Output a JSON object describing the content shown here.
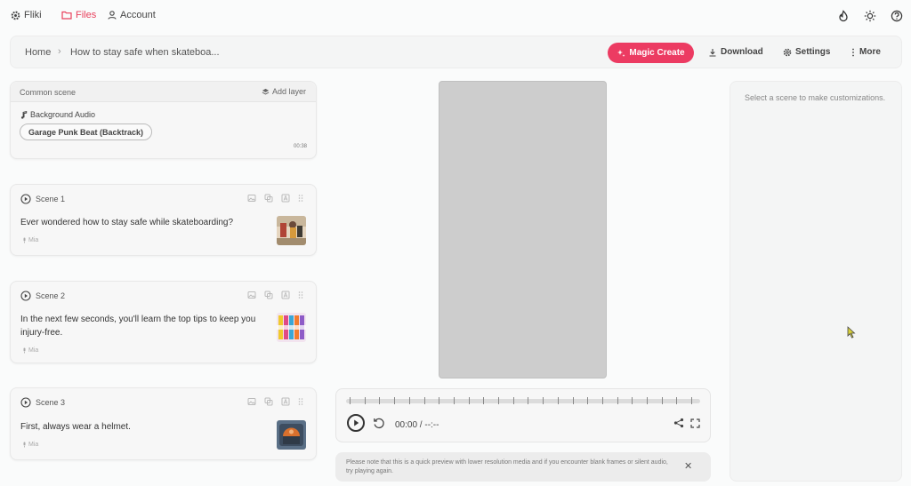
{
  "nav": {
    "brand": "Fliki",
    "files": "Files",
    "account": "Account",
    "icons": [
      "flame-icon",
      "sun-icon",
      "help-icon"
    ]
  },
  "toolbar": {
    "home": "Home",
    "separator": "›",
    "project_title": "How to stay safe when skateboa...",
    "magic_create": "Magic Create",
    "download": "Download",
    "settings": "Settings",
    "more": "More"
  },
  "common_scene": {
    "title": "Common scene",
    "add_layer": "Add layer",
    "bg_audio_label": "Background Audio",
    "track_name": "Garage Punk Beat (Backtrack)",
    "duration": "00:38"
  },
  "scenes": [
    {
      "label": "Scene 1",
      "text": "Ever wondered how to stay safe while skateboarding?",
      "voice": "Mia"
    },
    {
      "label": "Scene 2",
      "text": "In the next few seconds, you'll learn the top tips to keep you injury-free.",
      "voice": "Mia"
    },
    {
      "label": "Scene 3",
      "text": "First, always wear a helmet.",
      "voice": "Mia"
    }
  ],
  "player": {
    "time": "00:00 / --:--"
  },
  "notice": {
    "text": "Please note that this is a quick preview with lower resolution media and if you encounter blank frames or silent audio, try playing again.",
    "close": "✕"
  },
  "right_panel": {
    "hint": "Select a scene to make customizations."
  },
  "colors": {
    "accent": "#ec3b62",
    "preview_bg": "#cdcdcd"
  }
}
